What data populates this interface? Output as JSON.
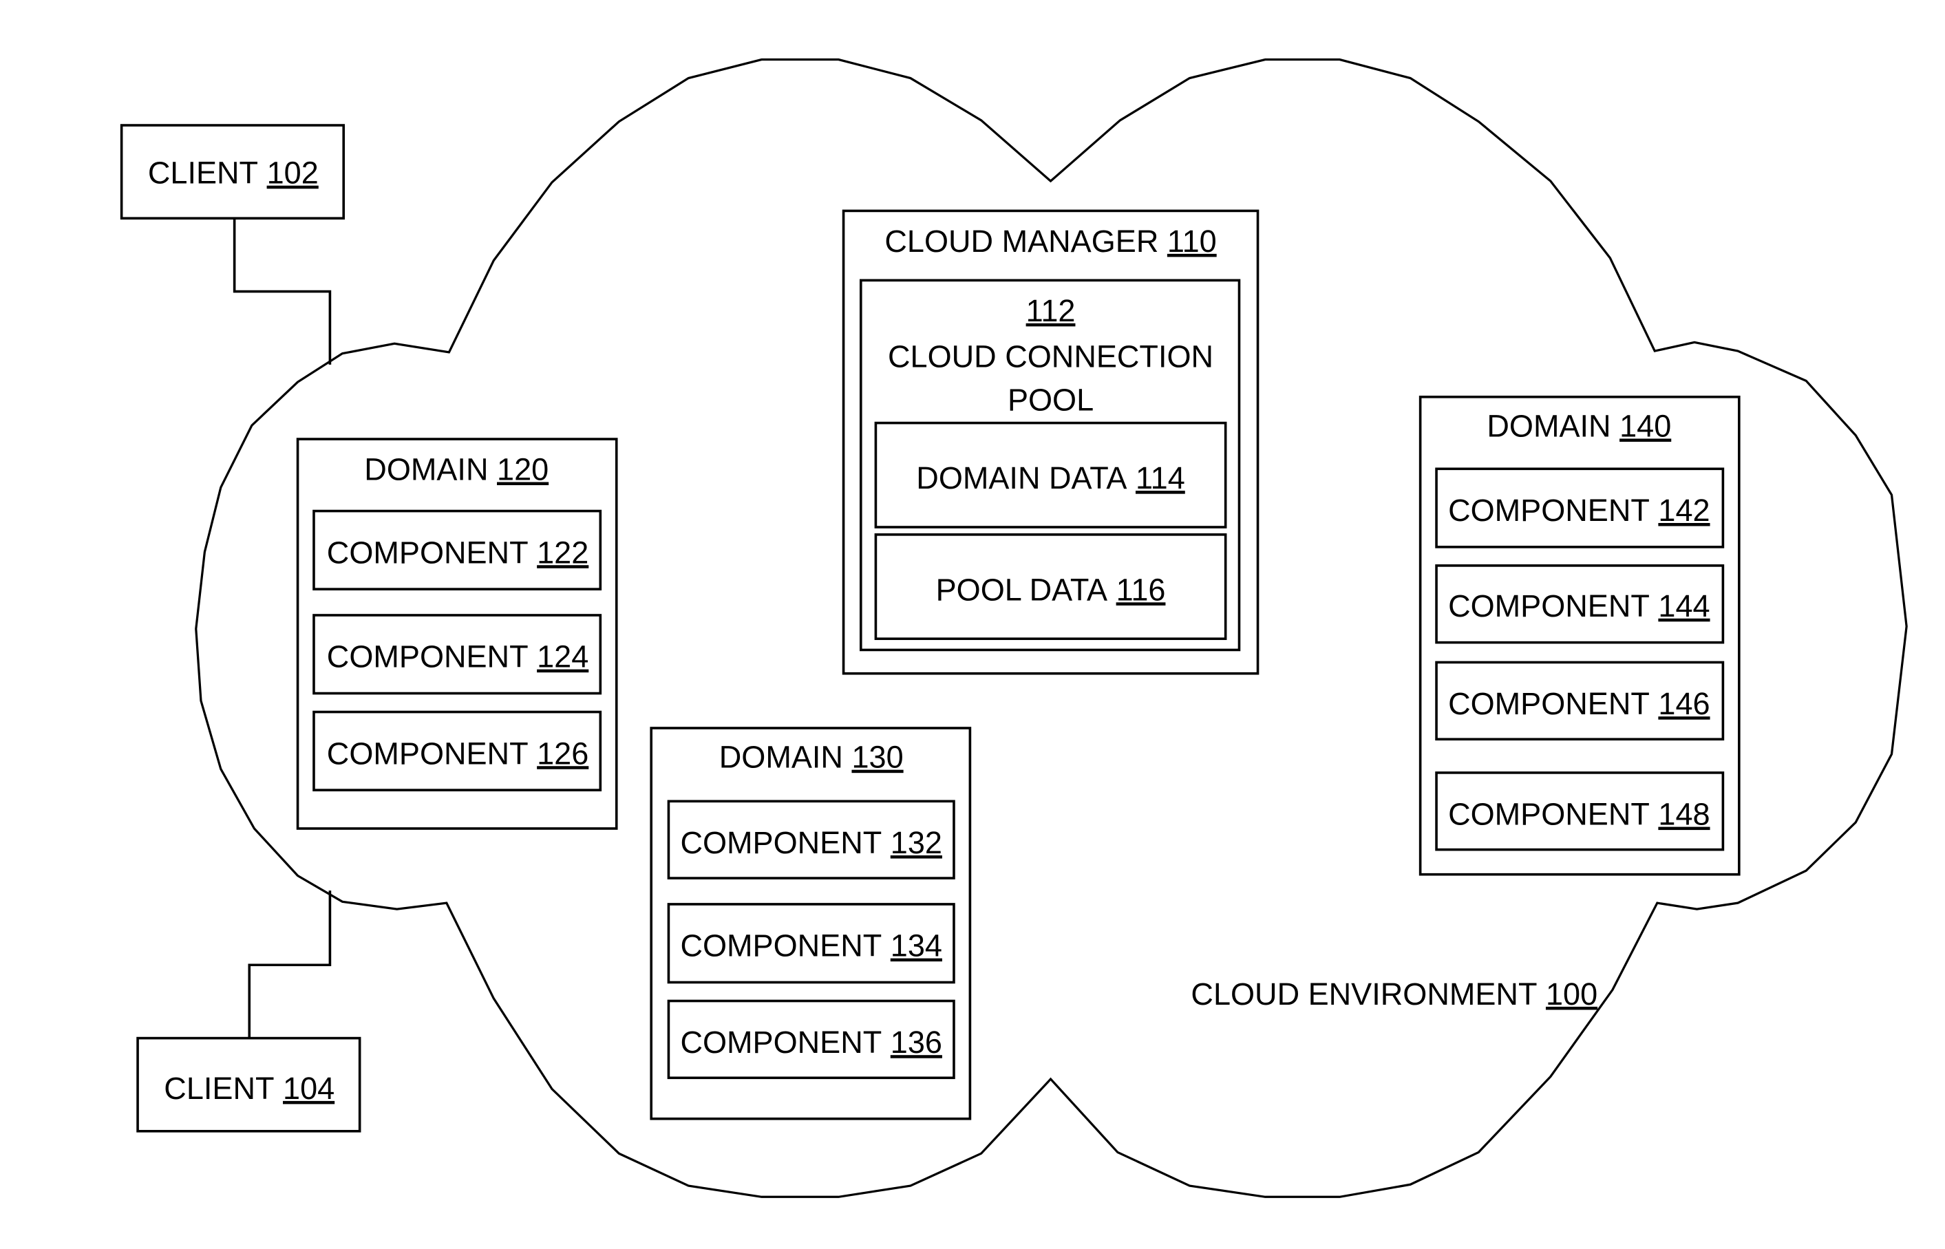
{
  "diagram": {
    "cloud": {
      "label": "CLOUD ENVIRONMENT",
      "ref": "100"
    },
    "clients": [
      {
        "label": "CLIENT",
        "ref": "102"
      },
      {
        "label": "CLIENT",
        "ref": "104"
      }
    ],
    "cloud_manager": {
      "label": "CLOUD MANAGER",
      "ref": "110",
      "pool": {
        "ref": "112",
        "label_line1": "CLOUD CONNECTION",
        "label_line2": "POOL",
        "items": [
          {
            "label": "DOMAIN DATA",
            "ref": "114"
          },
          {
            "label": "POOL DATA",
            "ref": "116"
          }
        ]
      }
    },
    "domains": [
      {
        "label": "DOMAIN",
        "ref": "120",
        "components": [
          {
            "label": "COMPONENT",
            "ref": "122"
          },
          {
            "label": "COMPONENT",
            "ref": "124"
          },
          {
            "label": "COMPONENT",
            "ref": "126"
          }
        ]
      },
      {
        "label": "DOMAIN",
        "ref": "130",
        "components": [
          {
            "label": "COMPONENT",
            "ref": "132"
          },
          {
            "label": "COMPONENT",
            "ref": "134"
          },
          {
            "label": "COMPONENT",
            "ref": "136"
          }
        ]
      },
      {
        "label": "DOMAIN",
        "ref": "140",
        "components": [
          {
            "label": "COMPONENT",
            "ref": "142"
          },
          {
            "label": "COMPONENT",
            "ref": "144"
          },
          {
            "label": "COMPONENT",
            "ref": "146"
          },
          {
            "label": "COMPONENT",
            "ref": "148"
          }
        ]
      }
    ]
  }
}
